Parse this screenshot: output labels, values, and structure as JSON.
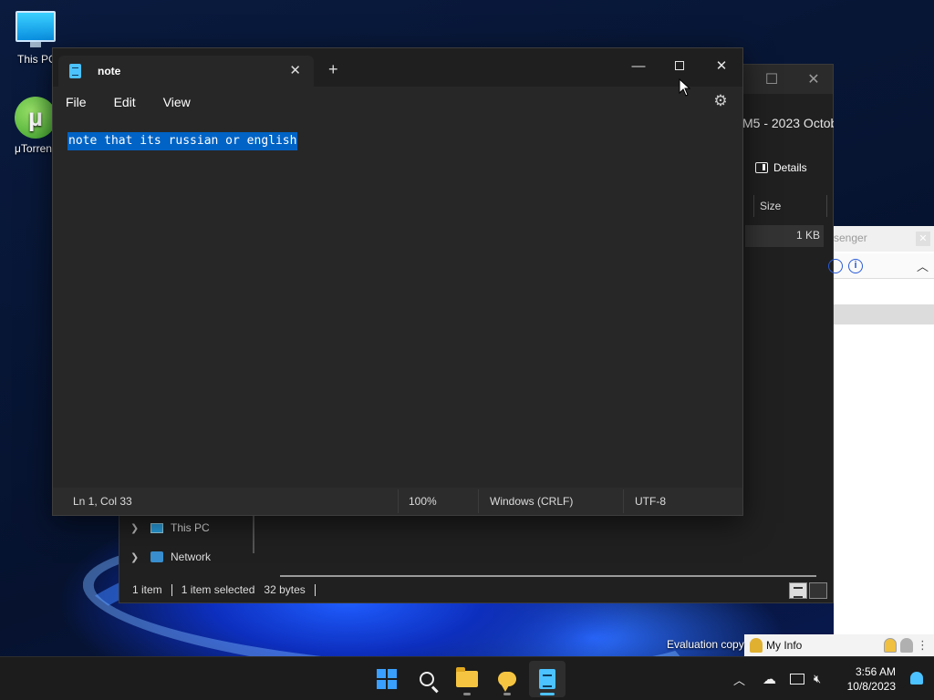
{
  "desktop": {
    "icons": [
      {
        "label": "This PC"
      },
      {
        "label": "μTorrent"
      }
    ],
    "watermark": "Evaluation copy"
  },
  "explorer": {
    "path_fragment": "M5 - 2023 Octob",
    "details_label": "Details",
    "column_size": "Size",
    "row_size": "1 KB",
    "nav": [
      {
        "label": "This PC"
      },
      {
        "label": "Network"
      }
    ],
    "status": {
      "count": "1 item",
      "selected": "1 item selected",
      "size": "32 bytes"
    }
  },
  "messenger": {
    "title_fragment": "senger",
    "my_info": "My Info"
  },
  "notepad": {
    "tab_title": "note",
    "menu": [
      "File",
      "Edit",
      "View"
    ],
    "content": "note that its russian or english",
    "selection_color": "#0063c5",
    "status": {
      "position": "Ln 1, Col 33",
      "zoom": "100%",
      "line_ending": "Windows (CRLF)",
      "encoding": "UTF-8"
    }
  },
  "taskbar": {
    "apps": [
      {
        "name": "start",
        "icon": "windows-logo-icon"
      },
      {
        "name": "search",
        "icon": "search-icon"
      },
      {
        "name": "file-explorer",
        "icon": "folder-icon"
      },
      {
        "name": "messenger",
        "icon": "chat-bubble-icon"
      },
      {
        "name": "notepad",
        "icon": "notepad-icon",
        "active": true
      }
    ],
    "clock": {
      "time": "3:56 AM",
      "date": "10/8/2023"
    }
  }
}
